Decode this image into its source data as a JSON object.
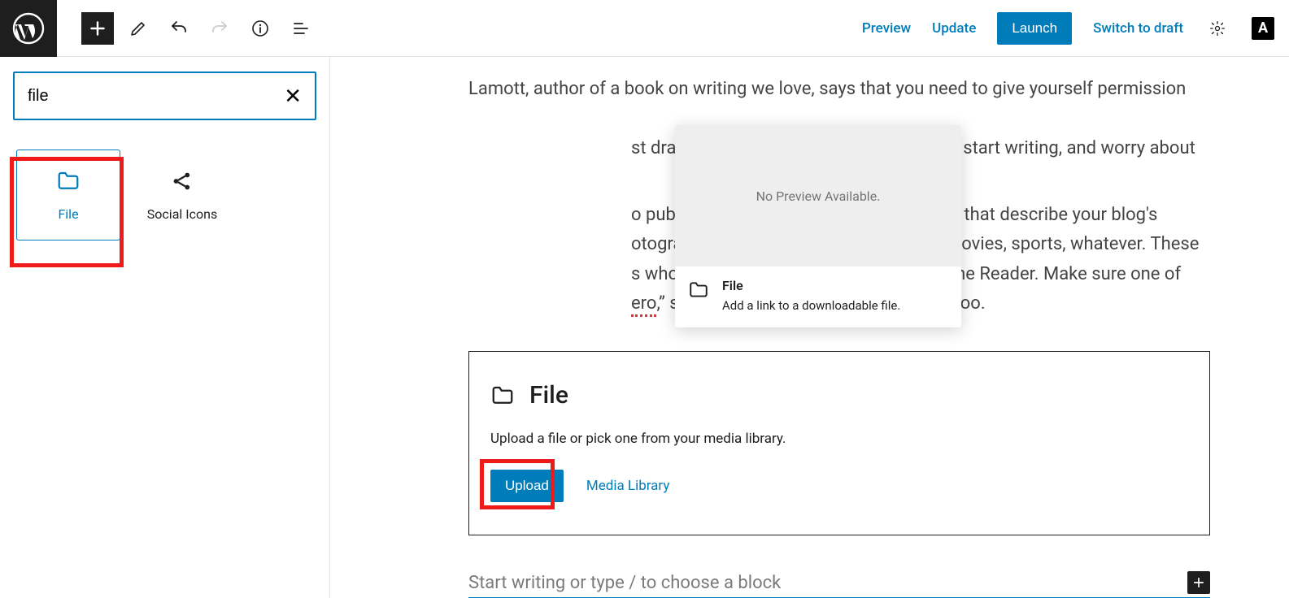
{
  "topbar": {
    "preview_label": "Preview",
    "update_label": "Update",
    "launch_label": "Launch",
    "switch_draft_label": "Switch to draft"
  },
  "inserter": {
    "search_value": "file",
    "blocks": [
      {
        "name": "File",
        "icon": "folder",
        "selected": true
      },
      {
        "name": "Social Icons",
        "icon": "share",
        "selected": false
      }
    ]
  },
  "popover": {
    "no_preview": "No Preview Available.",
    "title": "File",
    "description": "Add a link to a downloadable file."
  },
  "editor": {
    "para1_line1": "Lamott, author of a book on writing we love, says that you need to give yourself permission",
    "para1_line2": "st draft”. Anne makes a great point — just start writing, and worry about",
    "para2_line1": "o publish, give your post three to five tags that describe your blog's",
    "para2_line2": "otography, fiction, parenting, food, cars, movies, sports, whatever. These",
    "para2_line3": "s who care about your topics find you in the Reader. Make sure one of",
    "para2_line4a": "ero",
    "para2_line4b": ",” so other new bloggers can find you, too.",
    "file_block": {
      "title": "File",
      "description": "Upload a file or pick one from your media library.",
      "upload_label": "Upload",
      "media_library_label": "Media Library"
    },
    "new_block_placeholder": "Start writing or type / to choose a block"
  }
}
